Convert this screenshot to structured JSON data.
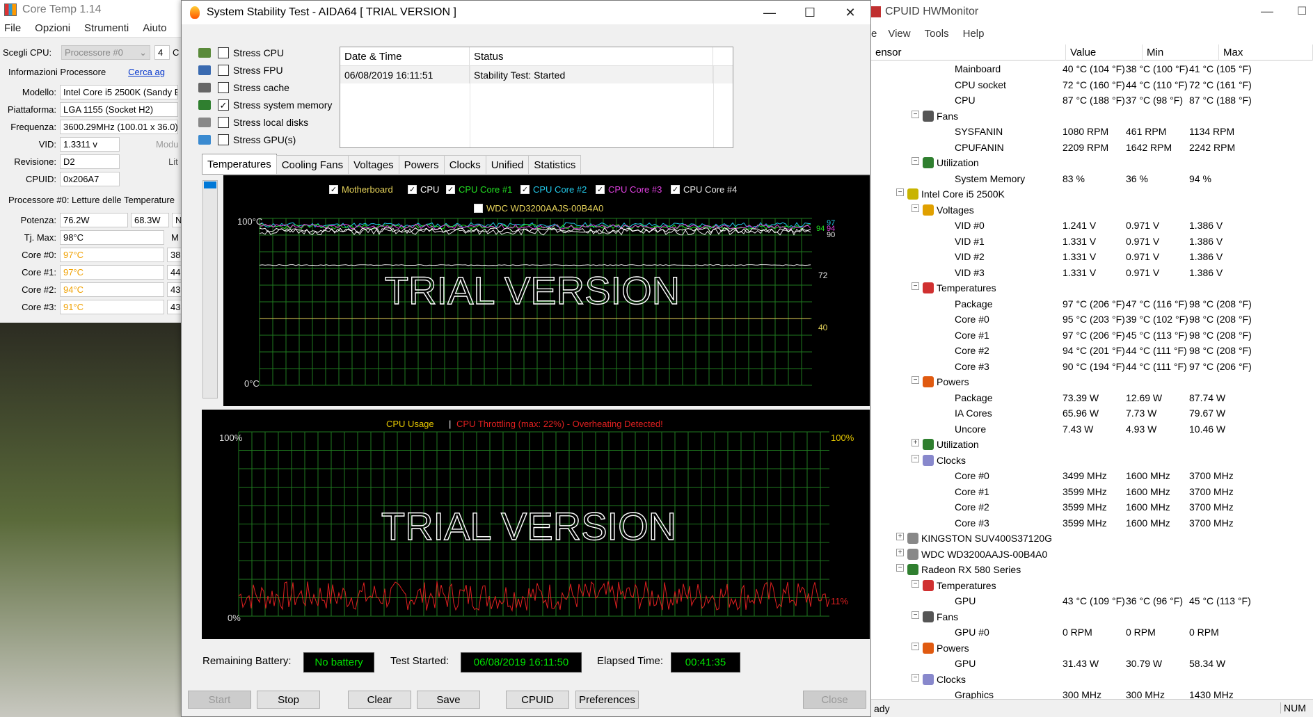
{
  "coretemp": {
    "title": "Core Temp 1.14",
    "menu": [
      "File",
      "Opzioni",
      "Strumenti",
      "Aiuto"
    ],
    "select_cpu_label": "Scegli CPU:",
    "select_cpu_value": "Processore #0",
    "cores_value": "4",
    "cores_cut": "C",
    "proc_info_label": "Informazioni Processore",
    "search_link": "Cerca ag",
    "fields": [
      {
        "label": "Modello:",
        "value": "Intel Core i5 2500K (Sandy B"
      },
      {
        "label": "Piattaforma:",
        "value": "LGA 1155 (Socket H2)"
      },
      {
        "label": "Frequenza:",
        "value": "3600.29MHz (100.01 x 36.0)"
      },
      {
        "label": "VID:",
        "value": "1.3311 v",
        "extra": "Modu"
      },
      {
        "label": "Revisione:",
        "value": "D2",
        "extra": "Lit"
      },
      {
        "label": "CPUID:",
        "value": "0x206A7"
      }
    ],
    "temps_label": "Processore #0: Letture delle Temperature",
    "power_label": "Potenza:",
    "power_values": [
      "76.2W",
      "68.3W",
      "N"
    ],
    "tjmax_label": "Tj. Max:",
    "tjmax_value": "98°C",
    "tjmax_extra": "M",
    "cores": [
      {
        "label": "Core #0:",
        "temp": "97°C",
        "extra": "38"
      },
      {
        "label": "Core #1:",
        "temp": "97°C",
        "extra": "44"
      },
      {
        "label": "Core #2:",
        "temp": "94°C",
        "extra": "43"
      },
      {
        "label": "Core #3:",
        "temp": "91°C",
        "extra": "43"
      }
    ]
  },
  "aida": {
    "title": "System Stability Test - AIDA64  [ TRIAL VERSION ]",
    "stress": [
      {
        "label": "Stress CPU",
        "checked": false,
        "icon_color": "#5a8a3a"
      },
      {
        "label": "Stress FPU",
        "checked": false,
        "icon_color": "#3a6ab0"
      },
      {
        "label": "Stress cache",
        "checked": false,
        "icon_color": "#666666"
      },
      {
        "label": "Stress system memory",
        "checked": true,
        "icon_color": "#2f7f2f"
      },
      {
        "label": "Stress local disks",
        "checked": false,
        "icon_color": "#888888"
      },
      {
        "label": "Stress GPU(s)",
        "checked": false,
        "icon_color": "#3a8ad0"
      }
    ],
    "table": {
      "col_datetime": "Date & Time",
      "col_status": "Status",
      "rows": [
        {
          "datetime": "06/08/2019 16:11:51",
          "status": "Stability Test: Started"
        }
      ]
    },
    "tabs": [
      "Temperatures",
      "Cooling Fans",
      "Voltages",
      "Powers",
      "Clocks",
      "Unified",
      "Statistics"
    ],
    "temp_graph": {
      "legend": [
        {
          "label": "Motherboard",
          "color": "#e6d35a"
        },
        {
          "label": "CPU",
          "color": "#ffffff"
        },
        {
          "label": "CPU Core #1",
          "color": "#22e022"
        },
        {
          "label": "CPU Core #2",
          "color": "#22c8e8"
        },
        {
          "label": "CPU Core #3",
          "color": "#e040e0"
        },
        {
          "label": "CPU Core #4",
          "color": "#e8e8e8"
        }
      ],
      "legend_disk": "WDC WD3200AAJS-00B4A0",
      "y_top": "100°C",
      "y_bottom": "0°C",
      "watermark": "TRIAL VERSION",
      "readouts": [
        {
          "text": "97",
          "color": "#22c8e8"
        },
        {
          "text": "94",
          "color": "#22e022"
        },
        {
          "text": "94",
          "color": "#e040e0"
        },
        {
          "text": "90",
          "color": "#e8e8e8"
        },
        {
          "text": "72",
          "color": "#e8e8e8"
        },
        {
          "text": "40",
          "color": "#e6d35a"
        }
      ]
    },
    "usage_graph": {
      "title_usage": "CPU Usage",
      "separator": "|",
      "title_throttle": "CPU Throttling (max: 22%) - Overheating Detected!",
      "y_top_left": "100%",
      "y_bottom_left": "0%",
      "y_top_right": "100%",
      "readout": "11%",
      "watermark": "TRIAL VERSION"
    },
    "info": {
      "battery_label": "Remaining Battery:",
      "battery_value": "No battery",
      "started_label": "Test Started:",
      "started_value": "06/08/2019 16:11:50",
      "elapsed_label": "Elapsed Time:",
      "elapsed_value": "00:41:35"
    },
    "buttons": {
      "start": "Start",
      "stop": "Stop",
      "clear": "Clear",
      "save": "Save",
      "cpuid": "CPUID",
      "preferences": "Preferences",
      "close": "Close"
    }
  },
  "hwmonitor": {
    "title": "CPUID HWMonitor",
    "menu_cut": "e",
    "menu": [
      "View",
      "Tools",
      "Help"
    ],
    "columns": [
      "ensor",
      "Value",
      "Min",
      "Max"
    ],
    "rows": [
      {
        "level": 3,
        "name": "Mainboard",
        "value": "40 °C  (104 °F)",
        "min": "38 °C  (100 °F)",
        "max": "41 °C  (105 °F)"
      },
      {
        "level": 3,
        "name": "CPU socket",
        "value": "72 °C  (160 °F)",
        "min": "44 °C  (110 °F)",
        "max": "72 °C  (161 °F)"
      },
      {
        "level": 3,
        "name": "CPU",
        "value": "87 °C  (188 °F)",
        "min": "37 °C  (98 °F)",
        "max": "87 °C  (188 °F)"
      },
      {
        "level": 2,
        "name": "Fans",
        "icon": "#555555",
        "toggle": "-"
      },
      {
        "level": 3,
        "name": "SYSFANIN",
        "value": "1080 RPM",
        "min": "461 RPM",
        "max": "1134 RPM"
      },
      {
        "level": 3,
        "name": "CPUFANIN",
        "value": "2209 RPM",
        "min": "1642 RPM",
        "max": "2242 RPM"
      },
      {
        "level": 2,
        "name": "Utilization",
        "icon": "#2f7f2f",
        "toggle": "-"
      },
      {
        "level": 3,
        "name": "System Memory",
        "value": "83 %",
        "min": "36 %",
        "max": "94 %"
      },
      {
        "level": 1,
        "name": "Intel Core i5 2500K",
        "icon": "#c8b400",
        "toggle": "-"
      },
      {
        "level": 2,
        "name": "Voltages",
        "icon": "#e0a000",
        "toggle": "-"
      },
      {
        "level": 3,
        "name": "VID #0",
        "value": "1.241 V",
        "min": "0.971 V",
        "max": "1.386 V"
      },
      {
        "level": 3,
        "name": "VID #1",
        "value": "1.331 V",
        "min": "0.971 V",
        "max": "1.386 V"
      },
      {
        "level": 3,
        "name": "VID #2",
        "value": "1.331 V",
        "min": "0.971 V",
        "max": "1.386 V"
      },
      {
        "level": 3,
        "name": "VID #3",
        "value": "1.331 V",
        "min": "0.971 V",
        "max": "1.386 V"
      },
      {
        "level": 2,
        "name": "Temperatures",
        "icon": "#d03030",
        "toggle": "-"
      },
      {
        "level": 3,
        "name": "Package",
        "value": "97 °C  (206 °F)",
        "min": "47 °C  (116 °F)",
        "max": "98 °C  (208 °F)"
      },
      {
        "level": 3,
        "name": "Core #0",
        "value": "95 °C  (203 °F)",
        "min": "39 °C  (102 °F)",
        "max": "98 °C  (208 °F)"
      },
      {
        "level": 3,
        "name": "Core #1",
        "value": "97 °C  (206 °F)",
        "min": "45 °C  (113 °F)",
        "max": "98 °C  (208 °F)"
      },
      {
        "level": 3,
        "name": "Core #2",
        "value": "94 °C  (201 °F)",
        "min": "44 °C  (111 °F)",
        "max": "98 °C  (208 °F)"
      },
      {
        "level": 3,
        "name": "Core #3",
        "value": "90 °C  (194 °F)",
        "min": "44 °C  (111 °F)",
        "max": "97 °C  (206 °F)"
      },
      {
        "level": 2,
        "name": "Powers",
        "icon": "#e05a10",
        "toggle": "-"
      },
      {
        "level": 3,
        "name": "Package",
        "value": "73.39 W",
        "min": "12.69 W",
        "max": "87.74 W"
      },
      {
        "level": 3,
        "name": "IA Cores",
        "value": "65.96 W",
        "min": "7.73 W",
        "max": "79.67 W"
      },
      {
        "level": 3,
        "name": "Uncore",
        "value": "7.43 W",
        "min": "4.93 W",
        "max": "10.46 W"
      },
      {
        "level": 2,
        "name": "Utilization",
        "icon": "#2f7f2f",
        "toggle": "+"
      },
      {
        "level": 2,
        "name": "Clocks",
        "icon": "#8888cc",
        "toggle": "-"
      },
      {
        "level": 3,
        "name": "Core #0",
        "value": "3499 MHz",
        "min": "1600 MHz",
        "max": "3700 MHz"
      },
      {
        "level": 3,
        "name": "Core #1",
        "value": "3599 MHz",
        "min": "1600 MHz",
        "max": "3700 MHz"
      },
      {
        "level": 3,
        "name": "Core #2",
        "value": "3599 MHz",
        "min": "1600 MHz",
        "max": "3700 MHz"
      },
      {
        "level": 3,
        "name": "Core #3",
        "value": "3599 MHz",
        "min": "1600 MHz",
        "max": "3700 MHz"
      },
      {
        "level": 1,
        "name": "KINGSTON SUV400S37120G",
        "icon": "#888888",
        "toggle": "+"
      },
      {
        "level": 1,
        "name": "WDC WD3200AAJS-00B4A0",
        "icon": "#888888",
        "toggle": "+"
      },
      {
        "level": 1,
        "name": "Radeon RX 580 Series",
        "icon": "#2f7f2f",
        "toggle": "-"
      },
      {
        "level": 2,
        "name": "Temperatures",
        "icon": "#d03030",
        "toggle": "-"
      },
      {
        "level": 3,
        "name": "GPU",
        "value": "43 °C  (109 °F)",
        "min": "36 °C  (96 °F)",
        "max": "45 °C  (113 °F)"
      },
      {
        "level": 2,
        "name": "Fans",
        "icon": "#555555",
        "toggle": "-"
      },
      {
        "level": 3,
        "name": "GPU #0",
        "value": "0 RPM",
        "min": "0 RPM",
        "max": "0 RPM"
      },
      {
        "level": 2,
        "name": "Powers",
        "icon": "#e05a10",
        "toggle": "-"
      },
      {
        "level": 3,
        "name": "GPU",
        "value": "31.43 W",
        "min": "30.79 W",
        "max": "58.34 W"
      },
      {
        "level": 2,
        "name": "Clocks",
        "icon": "#8888cc",
        "toggle": "-"
      },
      {
        "level": 3,
        "name": "Graphics",
        "value": "300 MHz",
        "min": "300 MHz",
        "max": "1430 MHz"
      }
    ],
    "status_left": "ady",
    "status_right": "NUM"
  }
}
